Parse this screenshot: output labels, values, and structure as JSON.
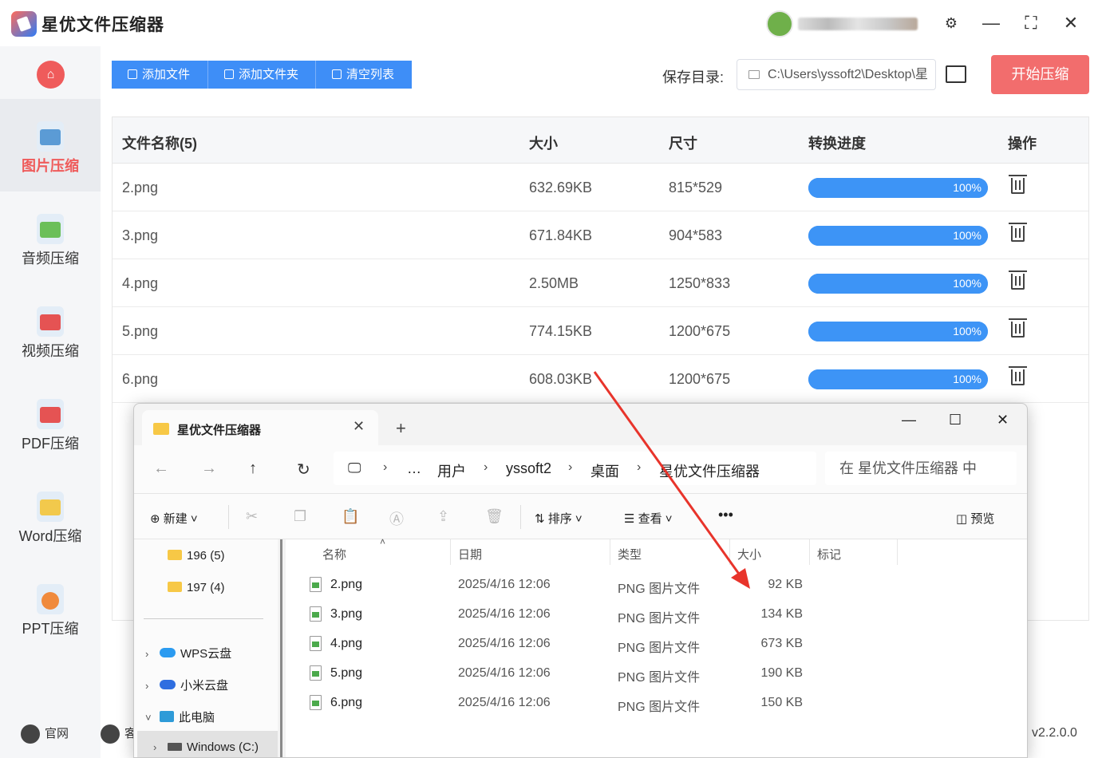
{
  "app": {
    "title": "星优文件压缩器",
    "version": "v2.2.0.0"
  },
  "window_controls": {
    "settings": "⚙",
    "minimize": "—",
    "maximize": "⛶",
    "close": "✕"
  },
  "sidebar": {
    "home_icon": "⌂",
    "items": [
      {
        "label": "图片压缩",
        "active": true,
        "color": "#5b9bd5"
      },
      {
        "label": "音频压缩",
        "active": false,
        "color": "#6bbf59"
      },
      {
        "label": "视频压缩",
        "active": false,
        "color": "#e55353"
      },
      {
        "label": "PDF压缩",
        "active": false,
        "color": "#e55353"
      },
      {
        "label": "Word压缩",
        "active": false,
        "color": "#f2c94c"
      },
      {
        "label": "PPT压缩",
        "active": false,
        "color": "#f08a3c"
      }
    ],
    "footer": {
      "website": "官网",
      "service": "客"
    }
  },
  "toolbar": {
    "add_file": "添加文件",
    "add_folder": "添加文件夹",
    "clear_list": "清空列表",
    "save_dir_label": "保存目录:",
    "save_dir_value": "C:\\Users\\yssoft2\\Desktop\\星",
    "start": "开始压缩"
  },
  "table": {
    "headers": [
      "文件名称(5)",
      "大小",
      "尺寸",
      "转换进度",
      "操作"
    ],
    "rows": [
      {
        "name": "2.png",
        "size": "632.69KB",
        "dims": "815*529",
        "progress": 100,
        "progress_label": "100%"
      },
      {
        "name": "3.png",
        "size": "671.84KB",
        "dims": "904*583",
        "progress": 100,
        "progress_label": "100%"
      },
      {
        "name": "4.png",
        "size": "2.50MB",
        "dims": "1250*833",
        "progress": 100,
        "progress_label": "100%"
      },
      {
        "name": "5.png",
        "size": "774.15KB",
        "dims": "1200*675",
        "progress": 100,
        "progress_label": "100%"
      },
      {
        "name": "6.png",
        "size": "608.03KB",
        "dims": "1200*675",
        "progress": 100,
        "progress_label": "100%"
      }
    ]
  },
  "explorer": {
    "tab_title": "星优文件压缩器",
    "tab_close": "✕",
    "new_tab": "+",
    "nav": {
      "back": "←",
      "forward": "→",
      "up": "↑",
      "refresh": "↻"
    },
    "breadcrumb": [
      "…",
      "用户",
      "yssoft2",
      "桌面",
      "星优文件压缩器"
    ],
    "search_placeholder": "在 星优文件压缩器 中",
    "commands": {
      "new": "新建",
      "sort": "排序",
      "view": "查看",
      "more": "•••",
      "preview": "预览"
    },
    "sidebar": {
      "folders": [
        "196 (5)",
        "197 (4)"
      ],
      "locations": [
        "WPS云盘",
        "小米云盘",
        "此电脑",
        "Windows (C:)"
      ]
    },
    "columns": [
      "名称",
      "日期",
      "类型",
      "大小",
      "标记"
    ],
    "files": [
      {
        "name": "2.png",
        "date": "2025/4/16 12:06",
        "type": "PNG 图片文件",
        "size": "92 KB"
      },
      {
        "name": "3.png",
        "date": "2025/4/16 12:06",
        "type": "PNG 图片文件",
        "size": "134 KB"
      },
      {
        "name": "4.png",
        "date": "2025/4/16 12:06",
        "type": "PNG 图片文件",
        "size": "673 KB"
      },
      {
        "name": "5.png",
        "date": "2025/4/16 12:06",
        "type": "PNG 图片文件",
        "size": "190 KB"
      },
      {
        "name": "6.png",
        "date": "2025/4/16 12:06",
        "type": "PNG 图片文件",
        "size": "150 KB"
      }
    ]
  },
  "colors": {
    "accent": "#3e8ef7",
    "danger": "#f26d6d",
    "arrow": "#e8342b"
  }
}
